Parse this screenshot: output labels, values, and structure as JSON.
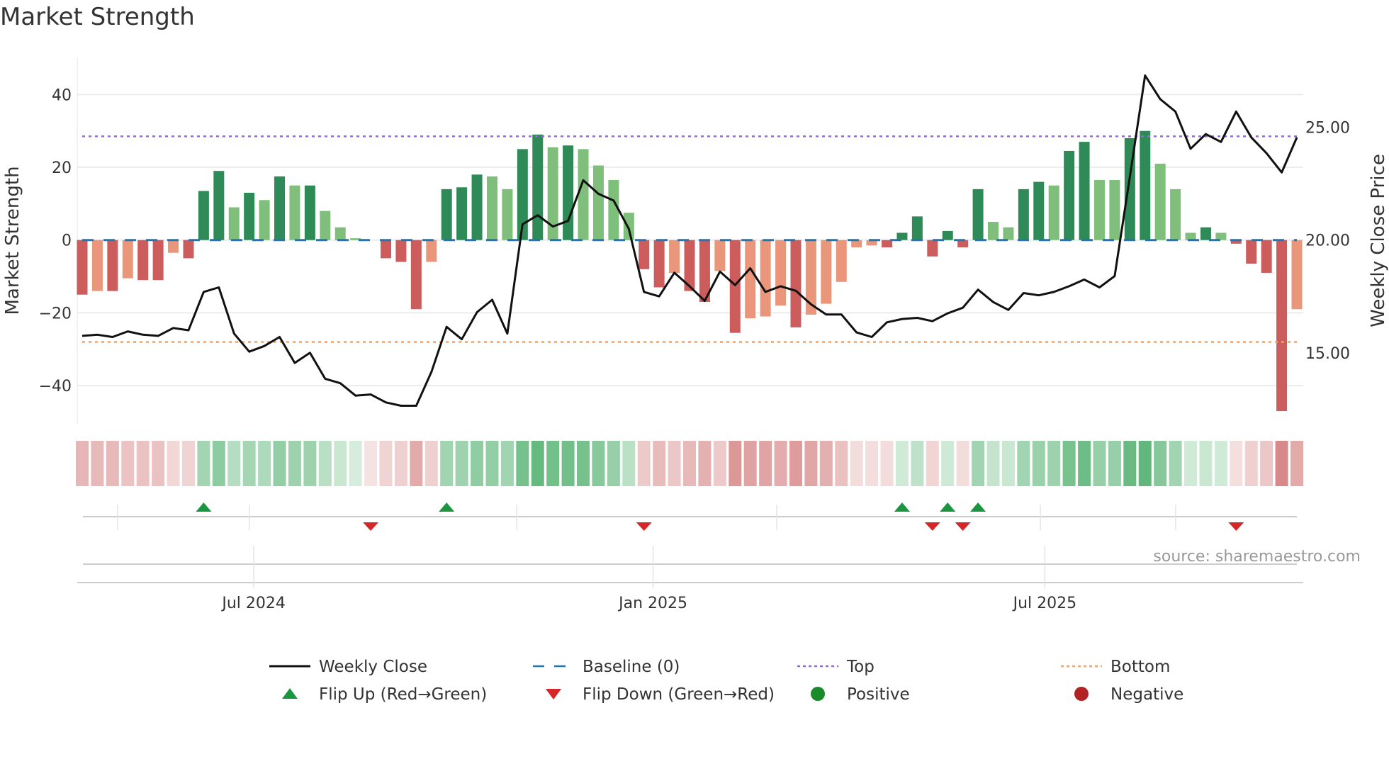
{
  "title": "Market Strength",
  "source": "source: sharemaestro.com",
  "colors": {
    "strong_pos": "#2e8b57",
    "weak_pos": "#7fbf7b",
    "strong_neg": "#cd5c5c",
    "weak_neg": "#e9967a",
    "price": "#111111",
    "baseline": "#1f77b4",
    "top": "#9467dd",
    "bottom": "#f4a460",
    "flip_up": "#1a9641",
    "flip_down": "#d62728",
    "positive": "#1a8a2a",
    "negative": "#b22222"
  },
  "chart_data": {
    "type": "bar",
    "title": "Market Strength",
    "ylabel": "Market Strength",
    "y2label": "Weekly Close Price",
    "ylim": [
      -50.5,
      50.2
    ],
    "y2lim": [
      11.85,
      28.1
    ],
    "yticks": [
      "40",
      "20",
      "0",
      "−20",
      "−40"
    ],
    "ytick_values": [
      40,
      20,
      0,
      -20,
      -40
    ],
    "y2ticks": [
      "25.00",
      "20.00",
      "15.00"
    ],
    "y2tick_values": [
      25,
      20,
      15
    ],
    "xticks": [
      "Jul 2024",
      "Jan 2025",
      "Jul 2025"
    ],
    "xtick_week_index": [
      11.3,
      37.6,
      63.4
    ],
    "top_level": 28.5,
    "bottom_level": -28,
    "strength": [
      -15,
      -14,
      -14,
      -10.5,
      -11,
      -11,
      -3.5,
      -5,
      13.5,
      19,
      9,
      13,
      11,
      17.5,
      15,
      15,
      8,
      3.5,
      0.5,
      0,
      -5,
      -6,
      -19,
      -6,
      14,
      14.5,
      18,
      17.5,
      14,
      25,
      29,
      25.5,
      26,
      25,
      20.5,
      16.5,
      7.5,
      -8,
      -13,
      -9,
      -14,
      -17,
      -8.5,
      -25.5,
      -21.5,
      -21,
      -18,
      -24,
      -20.5,
      -17.5,
      -11.5,
      -2,
      -1.5,
      -2,
      2,
      6.5,
      -4.5,
      2.5,
      -2,
      14,
      5,
      3.5,
      14,
      16,
      15,
      24.5,
      27,
      16.5,
      16.5,
      28,
      30,
      21,
      14,
      2,
      3.5,
      2,
      -1,
      -6.5,
      -9,
      -47,
      -19
    ],
    "strong": [
      1,
      0,
      1,
      0,
      1,
      1,
      0,
      1,
      1,
      1,
      0,
      1,
      0,
      1,
      0,
      1,
      0,
      0,
      0,
      0,
      1,
      1,
      1,
      0,
      1,
      1,
      1,
      0,
      0,
      1,
      1,
      0,
      1,
      0,
      0,
      0,
      0,
      1,
      1,
      0,
      1,
      1,
      0,
      1,
      0,
      0,
      0,
      1,
      0,
      0,
      0,
      0,
      0,
      1,
      1,
      1,
      1,
      1,
      1,
      1,
      0,
      0,
      1,
      1,
      0,
      1,
      1,
      0,
      0,
      1,
      1,
      0,
      0,
      0,
      1,
      0,
      1,
      1,
      1,
      1,
      0
    ],
    "weekly_close": [
      15.75,
      15.8,
      15.7,
      15.95,
      15.8,
      15.75,
      16.1,
      16.0,
      17.7,
      17.9,
      15.85,
      15.05,
      15.3,
      15.7,
      14.55,
      15.0,
      13.85,
      13.65,
      13.1,
      13.15,
      12.8,
      12.65,
      12.65,
      14.15,
      16.15,
      15.6,
      16.8,
      17.35,
      15.85,
      20.7,
      21.1,
      20.6,
      20.85,
      22.65,
      22.05,
      21.75,
      20.5,
      17.7,
      17.5,
      18.55,
      17.95,
      17.3,
      18.6,
      18.0,
      18.75,
      17.7,
      17.95,
      17.75,
      17.15,
      16.7,
      16.7,
      15.9,
      15.7,
      16.35,
      16.5,
      16.55,
      16.4,
      16.75,
      17.0,
      17.8,
      17.25,
      16.9,
      17.65,
      17.55,
      17.7,
      17.95,
      18.25,
      17.9,
      18.4,
      22.8,
      27.3,
      26.25,
      25.7,
      24.05,
      24.7,
      24.35,
      25.7,
      24.55,
      23.85,
      23.0,
      24.55
    ],
    "flip_up_weeks": [
      8,
      24,
      54,
      57,
      59
    ],
    "flip_down_weeks": [
      19,
      37,
      56,
      58,
      76
    ],
    "legend": [
      "Weekly Close",
      "Baseline (0)",
      "Top",
      "Bottom",
      "Flip Up (Red→Green)",
      "Flip Down (Green→Red)",
      "Positive",
      "Negative"
    ]
  }
}
